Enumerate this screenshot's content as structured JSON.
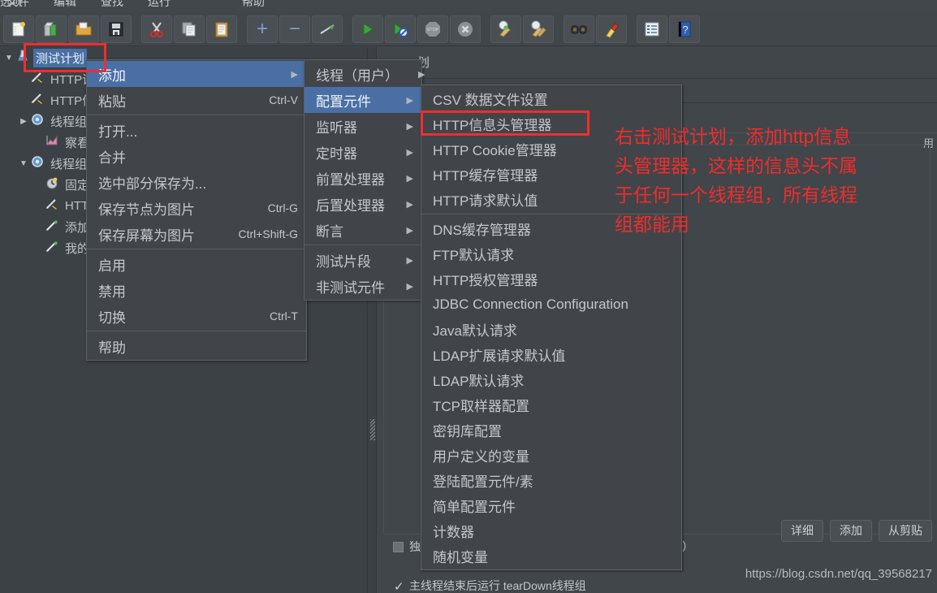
{
  "menubar": {
    "items": [
      "文件",
      "编辑",
      "查找",
      "运行",
      "选项",
      "帮助"
    ]
  },
  "toolbar": {
    "buttons": [
      {
        "name": "new-icon",
        "glyph": "🗒"
      },
      {
        "name": "templates-icon",
        "glyph": "📗"
      },
      {
        "name": "open-icon",
        "glyph": "📂"
      },
      {
        "name": "save-icon",
        "glyph": "💾"
      },
      {
        "name": "cut-icon",
        "glyph": "✂"
      },
      {
        "name": "copy-icon",
        "glyph": "🗐"
      },
      {
        "name": "paste-icon",
        "glyph": "📋"
      },
      {
        "name": "expand-icon",
        "glyph": "＋"
      },
      {
        "name": "collapse-icon",
        "glyph": "－"
      },
      {
        "name": "toggle-icon",
        "glyph": "🖉"
      },
      {
        "name": "start-icon",
        "glyph": "▶"
      },
      {
        "name": "start-no-pause-icon",
        "glyph": "▶"
      },
      {
        "name": "stop-icon",
        "glyph": "STOP"
      },
      {
        "name": "shutdown-icon",
        "glyph": "✖"
      },
      {
        "name": "clear-icon",
        "glyph": "🧹"
      },
      {
        "name": "clear-all-icon",
        "glyph": "🧹"
      },
      {
        "name": "search-icon",
        "glyph": "🔭"
      },
      {
        "name": "reset-search-icon",
        "glyph": "🧹"
      },
      {
        "name": "function-helper-icon",
        "glyph": "📘"
      },
      {
        "name": "help-icon",
        "glyph": "❓"
      }
    ]
  },
  "tree": {
    "nodes": [
      {
        "label": "测试计划",
        "icon": "test-plan-icon",
        "glyph": "⚗",
        "arrow": "▼",
        "indent": 0,
        "selected": true
      },
      {
        "label": "HTTP请",
        "icon": "config-element-icon",
        "glyph": "🛠",
        "arrow": "",
        "indent": 1,
        "selected": false
      },
      {
        "label": "HTTP信",
        "icon": "config-element-icon",
        "glyph": "🛠",
        "arrow": "",
        "indent": 1,
        "selected": false
      },
      {
        "label": "线程组",
        "icon": "thread-group-icon",
        "glyph": "⚙",
        "arrow": "▶",
        "indent": 1,
        "selected": false
      },
      {
        "label": "察看结",
        "icon": "view-results-tree-icon",
        "glyph": "📈",
        "arrow": "",
        "indent": 2,
        "selected": false
      },
      {
        "label": "线程组",
        "icon": "thread-group-icon",
        "glyph": "⚙",
        "arrow": "▼",
        "indent": 1,
        "selected": false
      },
      {
        "label": "固定定",
        "icon": "timer-icon",
        "glyph": "🕐",
        "arrow": "",
        "indent": 2,
        "selected": false
      },
      {
        "label": "HTTP",
        "icon": "config-element-icon",
        "glyph": "🛠",
        "arrow": "",
        "indent": 2,
        "selected": false
      },
      {
        "label": "添加收",
        "icon": "assertion-icon",
        "glyph": "🖊",
        "arrow": "",
        "indent": 2,
        "selected": false
      },
      {
        "label": "我的收",
        "icon": "assertion-icon",
        "glyph": "🖊",
        "arrow": "",
        "indent": 2,
        "selected": false
      }
    ]
  },
  "main": {
    "title": "划",
    "right_label": "用",
    "checkbox_independent": "独立运行每个线程组（例如在一个组运行结束后再运行）",
    "checkbox_teardown": "主线程结束后运行 tearDown线程组",
    "buttons": [
      "详细",
      "添加",
      "从剪贴"
    ],
    "watermark": "https://blog.csdn.net/qq_39568217"
  },
  "menu1": {
    "items": [
      {
        "label": "添加",
        "accel": "",
        "submenu": true,
        "highlight": true,
        "sep_after": false
      },
      {
        "label": "粘贴",
        "accel": "Ctrl-V",
        "submenu": false,
        "highlight": false,
        "sep_after": true
      },
      {
        "label": "打开...",
        "accel": "",
        "submenu": false,
        "highlight": false,
        "sep_after": false
      },
      {
        "label": "合并",
        "accel": "",
        "submenu": false,
        "highlight": false,
        "sep_after": false
      },
      {
        "label": "选中部分保存为...",
        "accel": "",
        "submenu": false,
        "highlight": false,
        "sep_after": false
      },
      {
        "label": "保存节点为图片",
        "accel": "Ctrl-G",
        "submenu": false,
        "highlight": false,
        "sep_after": false
      },
      {
        "label": "保存屏幕为图片",
        "accel": "Ctrl+Shift-G",
        "submenu": false,
        "highlight": false,
        "sep_after": true
      },
      {
        "label": "启用",
        "accel": "",
        "submenu": false,
        "highlight": false,
        "sep_after": false
      },
      {
        "label": "禁用",
        "accel": "",
        "submenu": false,
        "highlight": false,
        "sep_after": false
      },
      {
        "label": "切换",
        "accel": "Ctrl-T",
        "submenu": false,
        "highlight": false,
        "sep_after": true
      },
      {
        "label": "帮助",
        "accel": "",
        "submenu": false,
        "highlight": false,
        "sep_after": false
      }
    ]
  },
  "menu2": {
    "items": [
      {
        "label": "线程（用户）",
        "submenu": true,
        "highlight": false,
        "sep_after": false
      },
      {
        "label": "配置元件",
        "submenu": true,
        "highlight": true,
        "sep_after": false
      },
      {
        "label": "监听器",
        "submenu": true,
        "highlight": false,
        "sep_after": false
      },
      {
        "label": "定时器",
        "submenu": true,
        "highlight": false,
        "sep_after": false
      },
      {
        "label": "前置处理器",
        "submenu": true,
        "highlight": false,
        "sep_after": false
      },
      {
        "label": "后置处理器",
        "submenu": true,
        "highlight": false,
        "sep_after": false
      },
      {
        "label": "断言",
        "submenu": true,
        "highlight": false,
        "sep_after": true
      },
      {
        "label": "测试片段",
        "submenu": true,
        "highlight": false,
        "sep_after": false
      },
      {
        "label": "非测试元件",
        "submenu": true,
        "highlight": false,
        "sep_after": false
      }
    ]
  },
  "menu3": {
    "items": [
      {
        "label": "CSV 数据文件设置",
        "sep_after": false
      },
      {
        "label": "HTTP信息头管理器",
        "sep_after": false
      },
      {
        "label": "HTTP Cookie管理器",
        "sep_after": false
      },
      {
        "label": "HTTP缓存管理器",
        "sep_after": false
      },
      {
        "label": "HTTP请求默认值",
        "sep_after": true
      },
      {
        "label": "DNS缓存管理器",
        "sep_after": false
      },
      {
        "label": "FTP默认请求",
        "sep_after": false
      },
      {
        "label": "HTTP授权管理器",
        "sep_after": false
      },
      {
        "label": "JDBC Connection Configuration",
        "sep_after": false
      },
      {
        "label": "Java默认请求",
        "sep_after": false
      },
      {
        "label": "LDAP扩展请求默认值",
        "sep_after": false
      },
      {
        "label": "LDAP默认请求",
        "sep_after": false
      },
      {
        "label": "TCP取样器配置",
        "sep_after": false
      },
      {
        "label": "密钥库配置",
        "sep_after": false
      },
      {
        "label": "用户定义的变量",
        "sep_after": false
      },
      {
        "label": "登陆配置元件/素",
        "sep_after": false
      },
      {
        "label": "简单配置元件",
        "sep_after": false
      },
      {
        "label": "计数器",
        "sep_after": false
      },
      {
        "label": "随机变量",
        "sep_after": false
      }
    ]
  },
  "annotations": {
    "color": "#f02c2c",
    "lines": [
      "右击测试计划，添加http信息",
      "头管理器，这样的信息头不属",
      "于任何一个线程组，所有线程",
      "组都能用"
    ]
  }
}
